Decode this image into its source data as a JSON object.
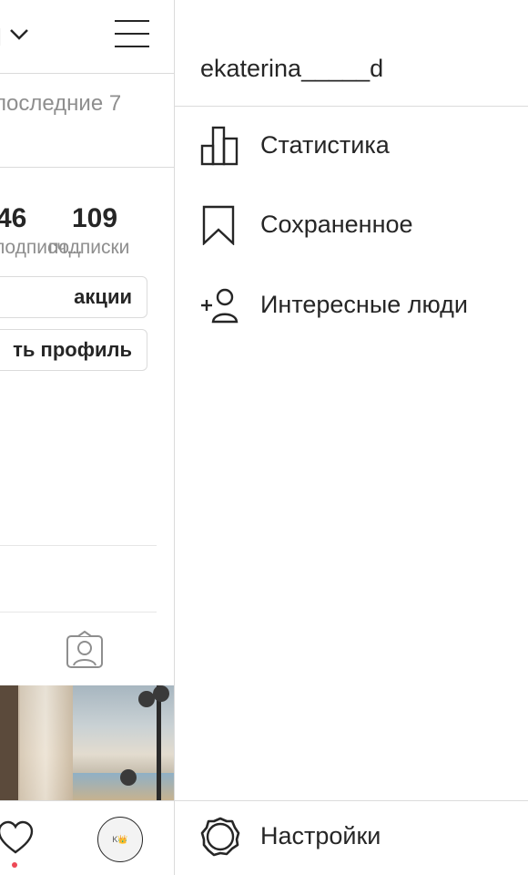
{
  "left": {
    "username_fragment": "l",
    "subtitle": "последние 7",
    "stats": [
      {
        "value": "46",
        "label": "подписч..."
      },
      {
        "value": "109",
        "label": "подписки"
      }
    ],
    "buttons": [
      "акции",
      "ть профиль"
    ],
    "avatar_text": "K👑"
  },
  "drawer": {
    "username": "ekaterina_____d",
    "items": [
      {
        "label": "Статистика",
        "icon": "bar-chart-icon"
      },
      {
        "label": "Сохраненное",
        "icon": "bookmark-icon"
      },
      {
        "label": "Интересные люди",
        "icon": "add-person-icon"
      }
    ],
    "footer": {
      "label": "Настройки",
      "icon": "gear-icon"
    }
  },
  "colors": {
    "text": "#262626",
    "secondary_text": "#8e8e8e",
    "divider": "#dbdbdb",
    "notification_dot": "#ed4956"
  }
}
